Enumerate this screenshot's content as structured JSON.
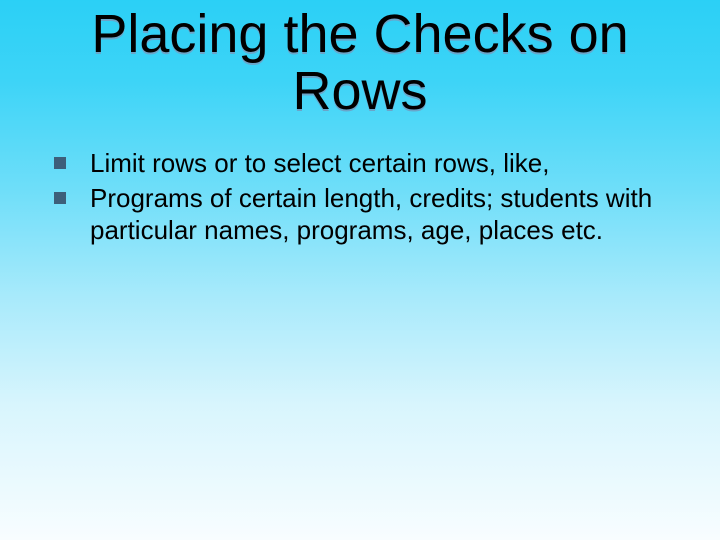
{
  "slide": {
    "title_line1": "Placing the Checks on",
    "title_line2": "Rows",
    "bullets": [
      {
        "text": "Limit rows or to select certain rows, like,"
      },
      {
        "text": "Programs of certain length, credits; students with particular names, programs, age, places etc."
      }
    ]
  }
}
